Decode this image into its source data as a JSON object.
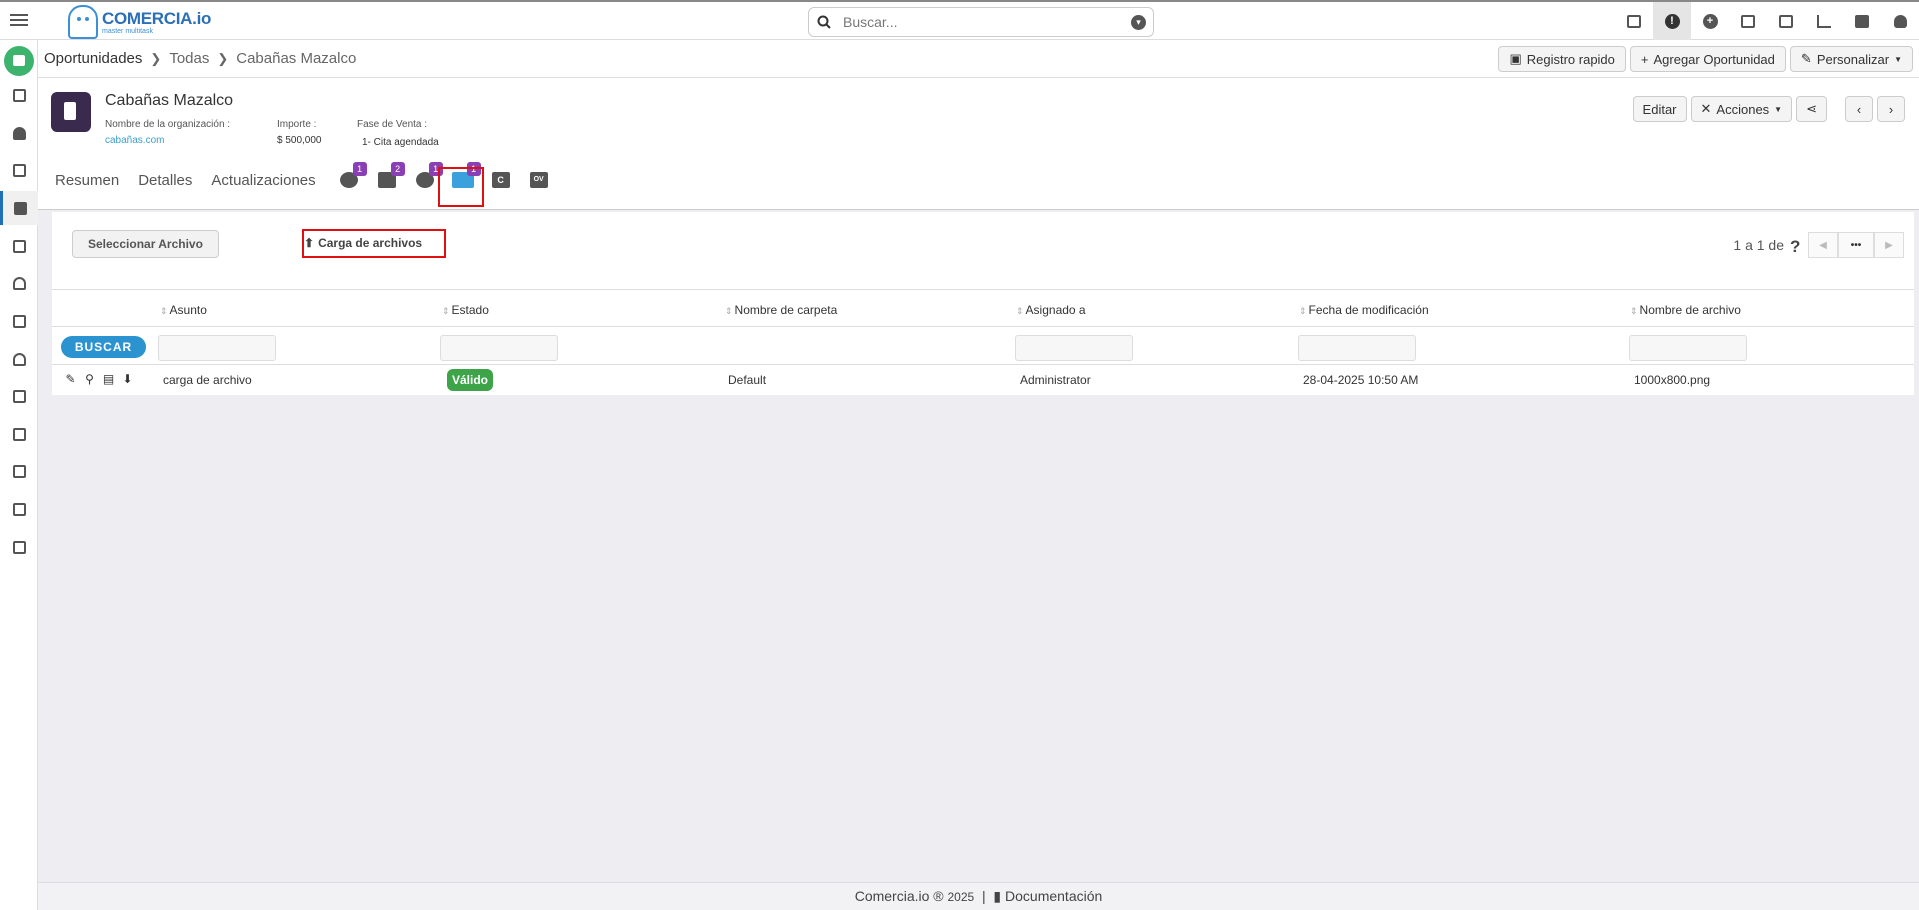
{
  "app": {
    "logo_name": "COMERCIA.io",
    "logo_tagline": "master multitask"
  },
  "search": {
    "placeholder": "Buscar..."
  },
  "breadcrumb": [
    "Oportunidades",
    "Todas",
    "Cabañas Mazalco"
  ],
  "crumb_actions": {
    "quick": "Registro rapido",
    "add": "Agregar Oportunidad",
    "customize": "Personalizar"
  },
  "record": {
    "title": "Cabañas Mazalco",
    "org_label": "Nombre de la organización :",
    "org_value": "cabañas.com",
    "amount_label": "Importe :",
    "amount_value": "$ 500,000",
    "stage_label": "Fase de Venta :",
    "stage_value": "1- Cita agendada",
    "edit": "Editar",
    "actions": "Acciones"
  },
  "tabs": {
    "summary": "Resumen",
    "details": "Detalles",
    "updates": "Actualizaciones",
    "badges": [
      "1",
      "2",
      "1",
      "1"
    ],
    "doc_c": "C",
    "doc_ov": "OV"
  },
  "panel": {
    "select_file": "Seleccionar Archivo",
    "upload": "Carga de archivos",
    "pager_text": "1 a 1  de",
    "pager_more": "•••",
    "search_btn": "BUSCAR"
  },
  "table": {
    "headers": [
      "Asunto",
      "Estado",
      "Nombre de carpeta",
      "Asignado a",
      "Fecha de modificación",
      "Nombre de archivo"
    ],
    "row": {
      "subject": "carga de archivo",
      "status": "Válido",
      "folder": "Default",
      "assigned": "Administrator",
      "modified": "28-04-2025 10:50 AM",
      "filename": "1000x800.png"
    }
  },
  "footer": {
    "brand": "Comercia.io ®",
    "year": "2025",
    "sep": "|",
    "docs": "Documentación"
  },
  "colors": {
    "accent": "#2a93d0",
    "badge": "#8a3fb4",
    "valid": "#3ea44a",
    "highlight": "#e01010"
  }
}
